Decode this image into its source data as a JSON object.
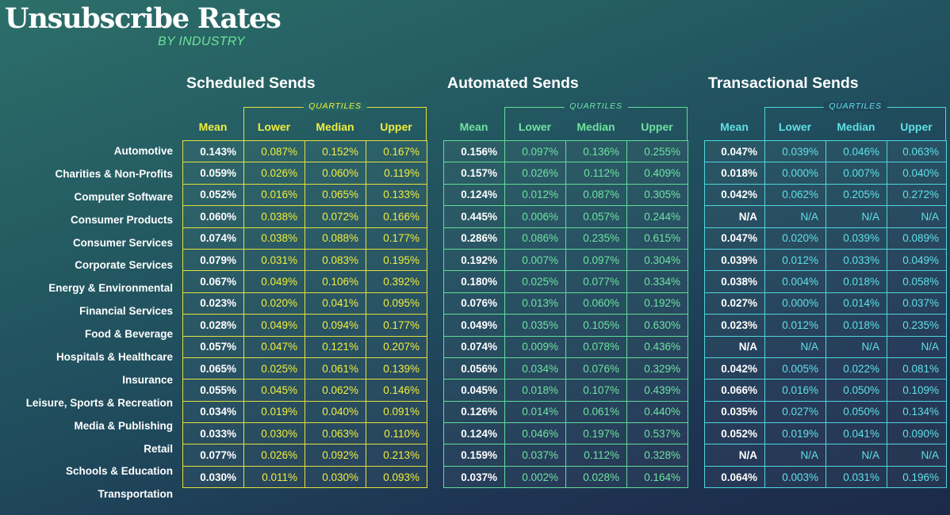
{
  "header": {
    "title": "Unsubscribe Rates",
    "subtitle": "BY INDUSTRY"
  },
  "chart_data": {
    "type": "table",
    "title": "Unsubscribe Rates",
    "subtitle": "BY INDUSTRY",
    "quartiles_label": "QUARTILES",
    "columns": [
      "Mean",
      "Lower",
      "Median",
      "Upper"
    ],
    "industries": [
      "Automotive",
      "Charities & Non-Profits",
      "Computer Software",
      "Consumer Products",
      "Consumer Services",
      "Corporate Services",
      "Energy & Environmental",
      "Financial Services",
      "Food & Beverage",
      "Hospitals & Healthcare",
      "Insurance",
      "Leisure, Sports & Recreation",
      "Media & Publishing",
      "Retail",
      "Schools & Education",
      "Transportation"
    ],
    "sections": [
      {
        "title": "Scheduled Sends",
        "accent": "#e4e23a",
        "rows": [
          [
            "0.143%",
            "0.087%",
            "0.152%",
            "0.167%"
          ],
          [
            "0.059%",
            "0.026%",
            "0.060%",
            "0.119%"
          ],
          [
            "0.052%",
            "0.016%",
            "0.065%",
            "0.133%"
          ],
          [
            "0.060%",
            "0.038%",
            "0.072%",
            "0.166%"
          ],
          [
            "0.074%",
            "0.038%",
            "0.088%",
            "0.177%"
          ],
          [
            "0.079%",
            "0.031%",
            "0.083%",
            "0.195%"
          ],
          [
            "0.067%",
            "0.049%",
            "0.106%",
            "0.392%"
          ],
          [
            "0.023%",
            "0.020%",
            "0.041%",
            "0.095%"
          ],
          [
            "0.028%",
            "0.049%",
            "0.094%",
            "0.177%"
          ],
          [
            "0.057%",
            "0.047%",
            "0.121%",
            "0.207%"
          ],
          [
            "0.065%",
            "0.025%",
            "0.061%",
            "0.139%"
          ],
          [
            "0.055%",
            "0.045%",
            "0.062%",
            "0.146%"
          ],
          [
            "0.034%",
            "0.019%",
            "0.040%",
            "0.091%"
          ],
          [
            "0.033%",
            "0.030%",
            "0.063%",
            "0.110%"
          ],
          [
            "0.077%",
            "0.026%",
            "0.092%",
            "0.213%"
          ],
          [
            "0.030%",
            "0.011%",
            "0.030%",
            "0.093%"
          ]
        ]
      },
      {
        "title": "Automated Sends",
        "accent": "#5fdc95",
        "rows": [
          [
            "0.156%",
            "0.097%",
            "0.136%",
            "0.255%"
          ],
          [
            "0.157%",
            "0.026%",
            "0.112%",
            "0.409%"
          ],
          [
            "0.124%",
            "0.012%",
            "0.087%",
            "0.305%"
          ],
          [
            "0.445%",
            "0.006%",
            "0.057%",
            "0.244%"
          ],
          [
            "0.286%",
            "0.086%",
            "0.235%",
            "0.615%"
          ],
          [
            "0.192%",
            "0.007%",
            "0.097%",
            "0.304%"
          ],
          [
            "0.180%",
            "0.025%",
            "0.077%",
            "0.334%"
          ],
          [
            "0.076%",
            "0.013%",
            "0.060%",
            "0.192%"
          ],
          [
            "0.049%",
            "0.035%",
            "0.105%",
            "0.630%"
          ],
          [
            "0.074%",
            "0.009%",
            "0.078%",
            "0.436%"
          ],
          [
            "0.056%",
            "0.034%",
            "0.076%",
            "0.329%"
          ],
          [
            "0.045%",
            "0.018%",
            "0.107%",
            "0.439%"
          ],
          [
            "0.126%",
            "0.014%",
            "0.061%",
            "0.440%"
          ],
          [
            "0.124%",
            "0.046%",
            "0.197%",
            "0.537%"
          ],
          [
            "0.159%",
            "0.037%",
            "0.112%",
            "0.328%"
          ],
          [
            "0.037%",
            "0.002%",
            "0.028%",
            "0.164%"
          ]
        ]
      },
      {
        "title": "Transactional Sends",
        "accent": "#4fd6dc",
        "rows": [
          [
            "0.047%",
            "0.039%",
            "0.046%",
            "0.063%"
          ],
          [
            "0.018%",
            "0.000%",
            "0.007%",
            "0.040%"
          ],
          [
            "0.042%",
            "0.062%",
            "0.205%",
            "0.272%"
          ],
          [
            "N/A",
            "N/A",
            "N/A",
            "N/A"
          ],
          [
            "0.047%",
            "0.020%",
            "0.039%",
            "0.089%"
          ],
          [
            "0.039%",
            "0.012%",
            "0.033%",
            "0.049%"
          ],
          [
            "0.038%",
            "0.004%",
            "0.018%",
            "0.058%"
          ],
          [
            "0.027%",
            "0.000%",
            "0.014%",
            "0.037%"
          ],
          [
            "0.023%",
            "0.012%",
            "0.018%",
            "0.235%"
          ],
          [
            "N/A",
            "N/A",
            "N/A",
            "N/A"
          ],
          [
            "0.042%",
            "0.005%",
            "0.022%",
            "0.081%"
          ],
          [
            "0.066%",
            "0.016%",
            "0.050%",
            "0.109%"
          ],
          [
            "0.035%",
            "0.027%",
            "0.050%",
            "0.134%"
          ],
          [
            "0.052%",
            "0.019%",
            "0.041%",
            "0.090%"
          ],
          [
            "N/A",
            "N/A",
            "N/A",
            "N/A"
          ],
          [
            "0.064%",
            "0.003%",
            "0.031%",
            "0.196%"
          ]
        ]
      }
    ]
  }
}
